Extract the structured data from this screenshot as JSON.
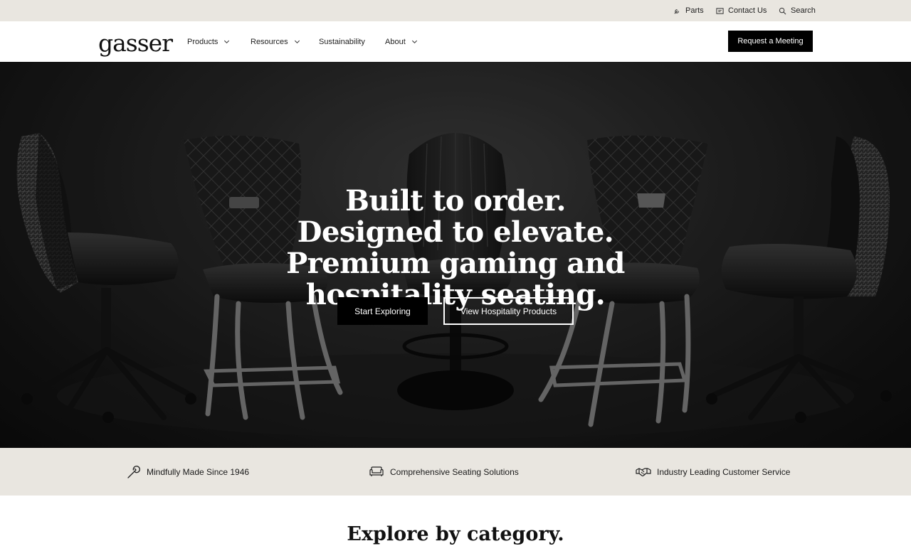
{
  "utility_bar": {
    "items": [
      {
        "label": "Parts",
        "icon": "wrench-icon"
      },
      {
        "label": "Contact Us",
        "icon": "message-icon"
      },
      {
        "label": "Search",
        "icon": "search-icon"
      }
    ]
  },
  "nav": {
    "logo": "gasser",
    "items": [
      {
        "label": "Products",
        "has_dropdown": true
      },
      {
        "label": "Resources",
        "has_dropdown": true
      },
      {
        "label": "Sustainability",
        "has_dropdown": false
      },
      {
        "label": "About",
        "has_dropdown": true
      }
    ],
    "cta_label": "Request a Meeting"
  },
  "hero": {
    "title": "Built to order. Designed to elevate. Premium gaming and hospitality seating.",
    "primary_button": "Start Exploring",
    "secondary_button": "View Hospitality Products"
  },
  "features": [
    {
      "label": "Mindfully Made Since 1946",
      "icon": "wrench-icon"
    },
    {
      "label": "Comprehensive Seating Solutions",
      "icon": "sofa-icon"
    },
    {
      "label": "Industry Leading Customer Service",
      "icon": "handshake-icon"
    }
  ],
  "category_section": {
    "heading": "Explore by category."
  },
  "colors": {
    "utility_bg": "#e9e6e0",
    "button_bg": "#000000",
    "hero_bg": "#1c1c1c"
  }
}
